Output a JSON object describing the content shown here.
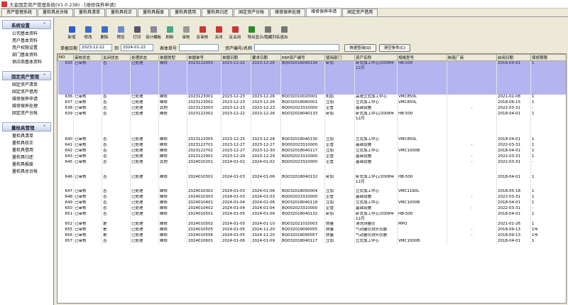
{
  "window": {
    "title": "大金固定资产管理系统(V1.0.238) - [维修保养申请]"
  },
  "tabs": [
    "资产管理系统",
    "量检具总台帐",
    "量检具清单",
    "量检具校正",
    "量检具报废",
    "量检具借用",
    "量检具归还",
    "固定资产台帐",
    "维修保养处理",
    "维修保养申请",
    "固定资产借用"
  ],
  "active_tab": 9,
  "sidebar": {
    "groups": [
      {
        "title": "系统设置",
        "items": [
          "公司基本资料",
          "用户基本资料",
          "用户权限设置",
          "部门基本资料",
          "供应商基本资料"
        ]
      },
      {
        "title": "固定资产管理",
        "items": [
          "固定资产清单",
          "固定资产借用",
          "维修保养申请",
          "维修保养处理",
          "固定资产台帐"
        ]
      },
      {
        "title": "量检具管理",
        "items": [
          "量检具清单",
          "量检具校正",
          "量检具借用",
          "量检具归还",
          "量检具报废",
          "量检具总台帐"
        ]
      }
    ]
  },
  "toolbar": [
    {
      "label": "新增",
      "icon": "add-icon",
      "color": "#2a5bd7"
    },
    {
      "label": "修改",
      "icon": "edit-icon",
      "color": "#3a6ad0"
    },
    {
      "label": "删除",
      "icon": "delete-icon",
      "color": "#3a6ad0"
    },
    {
      "label": "预览",
      "icon": "preview-icon",
      "color": "#6a8ac8"
    },
    {
      "label": "打印",
      "icon": "print-icon",
      "color": "#556"
    },
    {
      "label": "设计模板",
      "icon": "design-template-icon",
      "color": "#889"
    },
    {
      "label": "刷新",
      "icon": "refresh-icon",
      "color": "#4a8"
    },
    {
      "label": "审核",
      "icon": "audit-icon",
      "color": "#999"
    },
    {
      "label": "反审核",
      "icon": "unaudit-icon",
      "color": "#c33"
    },
    {
      "label": "关闭",
      "icon": "close-icon",
      "color": "#c33"
    },
    {
      "label": "反关闭",
      "icon": "reopen-icon",
      "color": "#c33"
    },
    {
      "label": "导出",
      "icon": "export-icon",
      "color": "#2a8a2a"
    },
    {
      "label": "显示/隐藏列名",
      "icon": "columns-icon",
      "color": "#777"
    },
    {
      "label": "退出",
      "icon": "exit-icon",
      "color": "#777"
    }
  ],
  "filter": {
    "date_label": "单据日期",
    "date_from": "2023-12-22",
    "to_label": "到",
    "date_to": "2024-01-22",
    "bill_no_label": "表体单号",
    "bill_no_value": "",
    "asset_label": "资产编号/名称",
    "asset_value": "",
    "query_button": "快速查询(Q)",
    "clear_button": "清空条件(C)"
  },
  "table": {
    "columns": [
      "NO.",
      "审核状态",
      "关闭状态",
      "处理状态",
      "单据类型",
      "单据单号",
      "单据日期",
      "要求日期",
      "ERP资产编号",
      "使用部门",
      "资产名称",
      "规格型号",
      "制造厂商",
      "启用日期",
      "保修期限"
    ],
    "rows": [
      [
        "635",
        "已审核",
        "否",
        "已处理",
        "维修",
        "2023122003",
        "2023-12-22",
        "2023-12-26",
        "BQ032018040134",
        "卧加",
        "卧式加工中心/2008年12月",
        "HB-500",
        "",
        "2018-04-01",
        "1"
      ],
      [
        "636",
        "已审核",
        "否",
        "已处理",
        "维修",
        "2023123001",
        "2023-12-23",
        "2023-12-26",
        "BQ032010020001",
        "机加",
        "高速立式加工中心",
        "VMC850L",
        "",
        "2021-02-08",
        "1"
      ],
      [
        "637",
        "已审核",
        "否",
        "已处理",
        "维修",
        "2023123002",
        "2023-12-23",
        "2023-12-26",
        "BQ032018060001",
        "立加",
        "立式加工中心",
        "VMC850L",
        "",
        "2018-06-15",
        "1"
      ],
      [
        "638",
        "已审核",
        "否",
        "已处理",
        "其他",
        "2023123003",
        "2023-12-23",
        "2023-12-23",
        "BQ002023310000",
        "企管",
        "基础设施",
        "",
        "-",
        "2022-03-31",
        "-"
      ],
      [
        "639",
        "已审核",
        "否",
        "已处理",
        "维修",
        "2023122002",
        "2023-12-22",
        "2023-12-26",
        "BQ032018040133",
        "卧加",
        "卧式加工中心/2008年12月",
        "HB-500",
        "",
        "2018-04-01",
        "1"
      ],
      [
        "640",
        "已审核",
        "否",
        "已处理",
        "维修",
        "2023122005",
        "2023-12-25",
        "2023-12-28",
        "BQ032018040130",
        "立加",
        "立式加工中心",
        "VMC850L",
        "",
        "2018-04-01",
        "1"
      ],
      [
        "641",
        "已审核",
        "否",
        "已处理",
        "维修",
        "2023122701",
        "2023-12-27",
        "2023-12-27",
        "BQ002023310000",
        "企管",
        "基础设施",
        "",
        "-",
        "2022-03-31",
        "1"
      ],
      [
        "642",
        "已审核",
        "否",
        "已处理",
        "维修",
        "2023122702",
        "2023-12-27",
        "2023-12-30",
        "BQ032018040117",
        "立加",
        "立式加工中心",
        "VMC1000B",
        "",
        "2018-04-01",
        "1"
      ],
      [
        "643",
        "已审核",
        "否",
        "已处理",
        "维修",
        "2023122901",
        "2023-12-29",
        "2023-12-29",
        "BQ002023310000",
        "企管",
        "基础设施",
        "",
        "-",
        "2022-03-31",
        "1"
      ],
      [
        "645",
        "已审核",
        "否",
        "已处理",
        "其他",
        "2024010201",
        "2024-01-02",
        "2024-01-02",
        "BQ002023310000",
        "企管",
        "基础设施",
        "",
        "-",
        "2022-03-31",
        "-"
      ],
      [
        "646",
        "已审核",
        "否",
        "已处理",
        "维修",
        "2024010301",
        "2024-01-03",
        "2024-01-06",
        "BQ032018040132",
        "卧加",
        "卧式加工中心/2008年12月",
        "HB-500",
        "",
        "2018-04-01",
        "1"
      ],
      [
        "647",
        "已审核",
        "否",
        "已处理",
        "维修",
        "2024010302",
        "2024-01-03",
        "2024-01-06",
        "BQ032018050004",
        "立加",
        "立式加工中心",
        "VMC1160L",
        "",
        "2018-05-18",
        "1"
      ],
      [
        "648",
        "已审核",
        "否",
        "已处理",
        "维修",
        "2024010303",
        "2024-01-03",
        "2024-01-03",
        "BQ002023310000",
        "企管",
        "基础设施",
        "",
        "-",
        "2022-03-31",
        "1"
      ],
      [
        "649",
        "已审核",
        "否",
        "已处理",
        "维修",
        "2024010401",
        "2024-01-04",
        "2024-01-06",
        "BQ032018040118",
        "立加",
        "立式加工中心",
        "VMC1000B",
        "",
        "2018-04-01",
        "1"
      ],
      [
        "650",
        "已审核",
        "否",
        "已处理",
        "维修",
        "2024010402",
        "2024-01-04",
        "2024-01-04",
        "BQ002023310000",
        "企管",
        "基础设施",
        "",
        "-",
        "2022-03-31",
        "-"
      ],
      [
        "651",
        "已审核",
        "否",
        "已处理",
        "维修",
        "2024010501",
        "2024-01-05",
        "2024-01-09",
        "BQ032018040132",
        "卧加",
        "卧式加工中心/2008年12月",
        "HB-500",
        "",
        "2018-04-01",
        "1"
      ],
      [
        "652",
        "已审核",
        "是",
        "已处理",
        "维修",
        "2024010502",
        "2024-01-05",
        "2024-01-10",
        "BQ032021010003",
        "质量",
        "清洗测量仪",
        "MPO",
        "",
        "2021-01-26",
        "1"
      ],
      [
        "655",
        "已审核",
        "是",
        "已处理",
        "维修",
        "2024010505",
        "2024-01-05",
        "2024-11-20",
        "BQ032018090055",
        "质量",
        "气动量仪测头仪器",
        "",
        "-",
        "2018-09-13",
        "1年"
      ],
      [
        "656",
        "已审核",
        "是",
        "已处理",
        "维修",
        "2024010506",
        "2024-01-05",
        "2024-11-20",
        "BQ032018090057",
        "质量",
        "气动量仪测头仪器",
        "",
        "-",
        "2018-09-13",
        "1年"
      ],
      [
        "657",
        "已审核",
        "否",
        "已处理",
        "维修",
        "2024010601",
        "2024-01-06",
        "2024-01-09",
        "BQ032018040117",
        "立加",
        "立式加工中心",
        "VMC1000B",
        "",
        "2018-04-01",
        "1"
      ]
    ],
    "selected_row": 0
  }
}
